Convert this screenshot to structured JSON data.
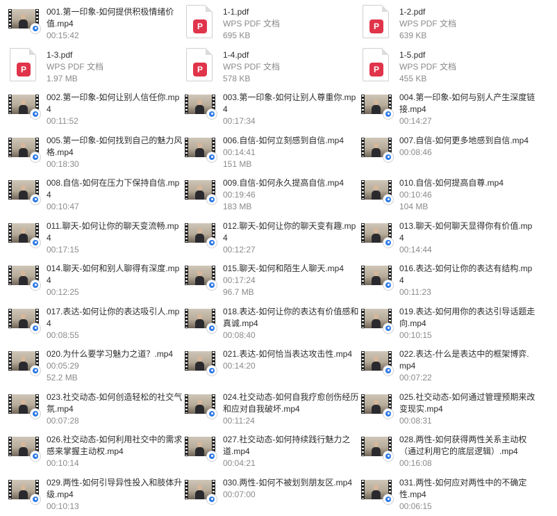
{
  "columns": [
    [
      {
        "type": "video",
        "name": "001.第一印象-如何提供积极情绪价值.mp4",
        "duration": "00:15:42"
      },
      {
        "type": "pdf",
        "name": "1-3.pdf",
        "kind": "WPS PDF 文档",
        "size": "1.97 MB"
      },
      {
        "type": "video",
        "name": "002.第一印象-如何让别人信任你.mp4",
        "duration": "00:11:52"
      },
      {
        "type": "video",
        "name": "005.第一印象-如何找到自己的魅力风格.mp4",
        "duration": "00:18:30"
      },
      {
        "type": "video",
        "name": "008.自信-如何在压力下保持自信.mp4",
        "duration": "00:10:47"
      },
      {
        "type": "video",
        "name": "011.聊天-如何让你的聊天变流畅.mp4",
        "duration": "00:17:15"
      },
      {
        "type": "video",
        "name": "014.聊天-如何和别人聊得有深度.mp4",
        "duration": "00:12:25"
      },
      {
        "type": "video",
        "name": "017.表达-如何让你的表达吸引人.mp4",
        "duration": "00:08:55"
      },
      {
        "type": "video",
        "name": "020.为什么要学习魅力之道？.mp4",
        "duration": "00:05:29",
        "size": "52.2 MB"
      },
      {
        "type": "video",
        "name": "023.社交动态-如何创造轻松的社交气氛.mp4",
        "duration": "00:07:28"
      },
      {
        "type": "video",
        "name": "026.社交动态-如何利用社交中的需求感来掌握主动权.mp4",
        "duration": "00:10:14"
      },
      {
        "type": "video",
        "name": "029.两性-如何引导异性投入和肢体升级.mp4",
        "duration": "00:10:13"
      }
    ],
    [
      {
        "type": "pdf",
        "name": "1-1.pdf",
        "kind": "WPS PDF 文档",
        "size": "695 KB"
      },
      {
        "type": "pdf",
        "name": "1-4.pdf",
        "kind": "WPS PDF 文档",
        "size": "578 KB"
      },
      {
        "type": "video",
        "name": "003.第一印象-如何让别人尊重你.mp4",
        "duration": "00:17:34"
      },
      {
        "type": "video",
        "name": "006.自信-如何立刻感到自信.mp4",
        "duration": "00:14:41",
        "size": "151 MB"
      },
      {
        "type": "video",
        "name": "009.自信-如何永久提高自信.mp4",
        "duration": "00:19:46",
        "size": "183 MB"
      },
      {
        "type": "video",
        "name": "012.聊天-如何让你的聊天变有趣.mp4",
        "duration": "00:12:27"
      },
      {
        "type": "video",
        "name": "015.聊天-如何和陌生人聊天.mp4",
        "duration": "00:17:24",
        "size": "96.7 MB"
      },
      {
        "type": "video",
        "name": "018.表达-如何让你的表达有价值感和真诚.mp4",
        "duration": "00:08:40"
      },
      {
        "type": "video",
        "name": "021.表达-如何恰当表达攻击性.mp4",
        "duration": "00:14:20"
      },
      {
        "type": "video",
        "name": "024.社交动态-如何自我疗愈创伤经历和应对自我破坏.mp4",
        "duration": "00:11:24"
      },
      {
        "type": "video",
        "name": "027.社交动态-如何持续践行魅力之道.mp4",
        "duration": "00:04:21"
      },
      {
        "type": "video",
        "name": "030.两性-如何不被划到朋友区.mp4",
        "duration": "00:07:00"
      }
    ],
    [
      {
        "type": "pdf",
        "name": "1-2.pdf",
        "kind": "WPS PDF 文档",
        "size": "639 KB"
      },
      {
        "type": "pdf",
        "name": "1-5.pdf",
        "kind": "WPS PDF 文档",
        "size": "455 KB"
      },
      {
        "type": "video",
        "name": "004.第一印象-如何与别人产生深度链接.mp4",
        "duration": "00:14:27"
      },
      {
        "type": "video",
        "name": "007.自信-如何更多地感到自信.mp4",
        "duration": "00:08:46"
      },
      {
        "type": "video",
        "name": "010.自信-如何提高自尊.mp4",
        "duration": "00:10:46",
        "size": "104 MB"
      },
      {
        "type": "video",
        "name": "013.聊天-如何聊天显得你有价值.mp4",
        "duration": "00:14:44"
      },
      {
        "type": "video",
        "name": "016.表达-如何让你的表达有结构.mp4",
        "duration": "00:11:23"
      },
      {
        "type": "video",
        "name": "019.表达-如何用你的表达引导话题走向.mp4",
        "duration": "00:10:15"
      },
      {
        "type": "video",
        "name": "022.表达-什么是表达中的框架博弈.mp4",
        "duration": "00:07:22"
      },
      {
        "type": "video",
        "name": "025.社交动态-如何通过管理预期来改变现实.mp4",
        "duration": "00:08:31"
      },
      {
        "type": "video",
        "name": "028.两性-如何获得两性关系主动权（通过利用它的底层逻辑）.mp4",
        "duration": "00:16:08"
      },
      {
        "type": "video",
        "name": "031.两性-如何应对两性中的不确定性.mp4",
        "duration": "00:06:15"
      }
    ]
  ]
}
